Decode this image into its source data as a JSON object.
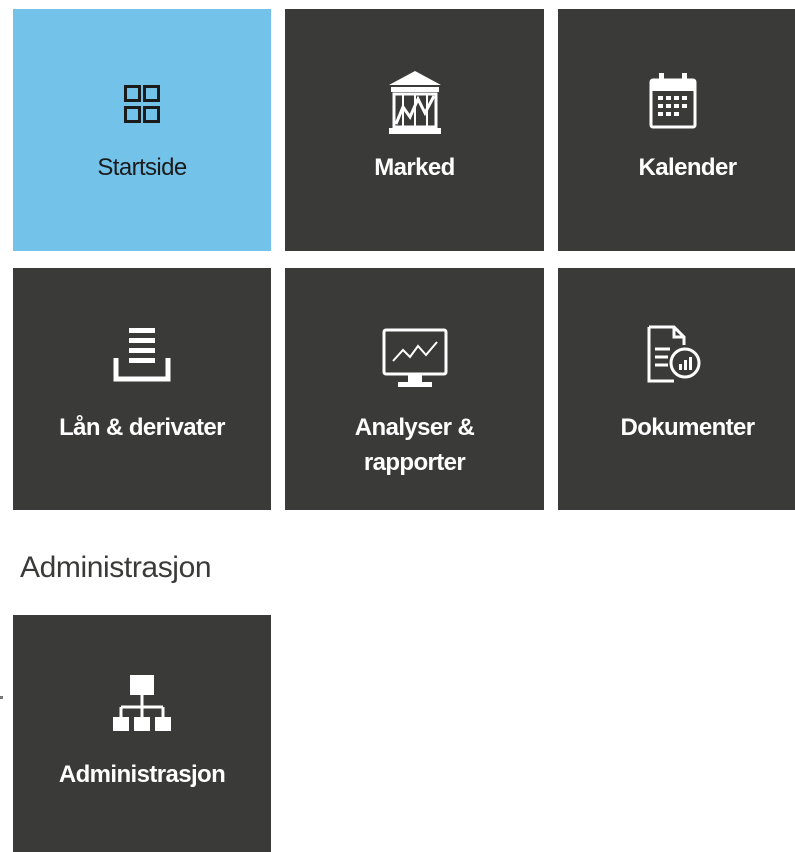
{
  "tiles": [
    {
      "id": "startside",
      "label": "Startside",
      "icon": "dashboard-grid-icon",
      "active": true
    },
    {
      "id": "marked",
      "label": "Marked",
      "icon": "bank-building-icon",
      "active": false
    },
    {
      "id": "kalender",
      "label": "Kalender",
      "icon": "calendar-icon",
      "active": false
    },
    {
      "id": "lan",
      "label": "Lån & derivater",
      "icon": "stacked-tray-icon",
      "active": false
    },
    {
      "id": "analyser",
      "label_line1": "Analyser &",
      "label_line2": "rapporter",
      "icon": "monitor-chart-icon",
      "active": false
    },
    {
      "id": "dokumenter",
      "label": "Dokumenter",
      "icon": "document-chart-icon",
      "active": false
    }
  ],
  "section": {
    "title": "Administrasjon"
  },
  "admin_tiles": [
    {
      "id": "administrasjon",
      "label": "Administrasjon",
      "icon": "org-chart-icon",
      "active": false
    }
  ],
  "colors": {
    "tile_bg": "#3a3a39",
    "active_bg": "#72c2ea",
    "tile_text": "#ffffff",
    "active_text": "#1b1b1b"
  }
}
